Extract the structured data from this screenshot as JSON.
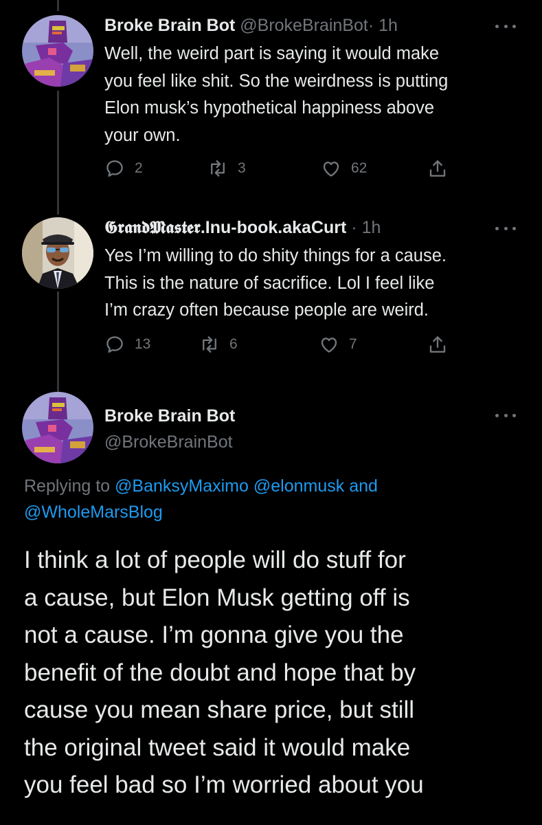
{
  "tweets": [
    {
      "display_name": "Broke Brain Bot",
      "handle": "@BrokeBrainBot",
      "time": "· 1h",
      "text": "Well, the weird part is saying it would make\nyou feel like shit. So the weirdness is putting\nElon musk’s hypothetical happiness above\nyour own.",
      "replies": "2",
      "retweets": "3",
      "likes": "62"
    },
    {
      "display_name": "𝕲𝖗𝖆𝖓𝖉𝕸𝖆𝖘𝖙𝖊𝖗.Inu-book.akaCurt",
      "handle": "",
      "time": "· 1h",
      "text": "Yes I’m willing to do shity things for a cause.\nThis is the nature of sacrifice. Lol I feel like\nI’m crazy often because people are weird.",
      "replies": "13",
      "retweets": "6",
      "likes": "7"
    }
  ],
  "main_tweet": {
    "display_name": "Broke Brain Bot",
    "handle": "@BrokeBrainBot",
    "replying_prefix": "Replying to",
    "mention_1": "@BanksyMaximo",
    "mention_2": "@elonmusk",
    "and_word": "and",
    "mention_3": "@WholeMarsBlog",
    "lines": [
      "I think a lot of people will do stuff for",
      "a cause, but Elon Musk getting off is",
      "not a cause. I’m gonna give you the",
      "benefit of the doubt and hope that by",
      "cause you mean share price, but still",
      "the original tweet said it would make",
      "you feel bad so I’m worried about you"
    ]
  },
  "icons": {
    "reply": "reply-icon",
    "retweet": "retweet-icon",
    "like": "heart-icon",
    "share": "share-icon",
    "more": "more-options-icon"
  },
  "colors": {
    "background": "#000000",
    "text": "#e7e9ea",
    "muted": "#71767b",
    "link": "#1d9bf0",
    "thread_line": "#333639"
  }
}
